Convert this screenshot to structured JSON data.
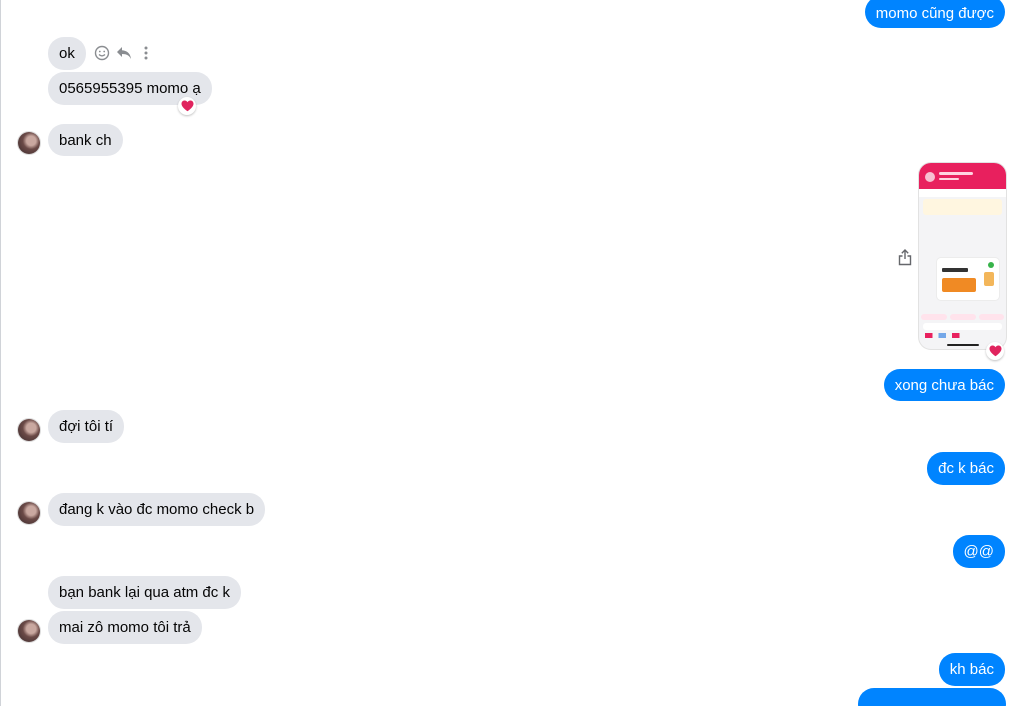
{
  "colors": {
    "outgoing": "#0084ff",
    "incoming": "#e4e6eb",
    "reaction": "#e0245e"
  },
  "icons": {
    "react": "smiley-icon",
    "reply": "reply-icon",
    "more": "more-vertical-icon",
    "share": "share-icon",
    "heart": "heart-icon"
  },
  "messages": {
    "m1": "momo cũng được",
    "m2": "ok",
    "m3": "0565955395  momo ạ",
    "m4": "bank ch",
    "m5": "xong chưa bác",
    "m6": "đợi tôi tí",
    "m7": "đc k bác",
    "m8": "đang k vào đc momo check b",
    "m9": "@@",
    "m10": "bạn bank lại qua atm đc k",
    "m11": "mai zô momo tôi trả",
    "m12": "kh bác"
  },
  "attachment": {
    "type": "image",
    "description": "screenshot"
  }
}
